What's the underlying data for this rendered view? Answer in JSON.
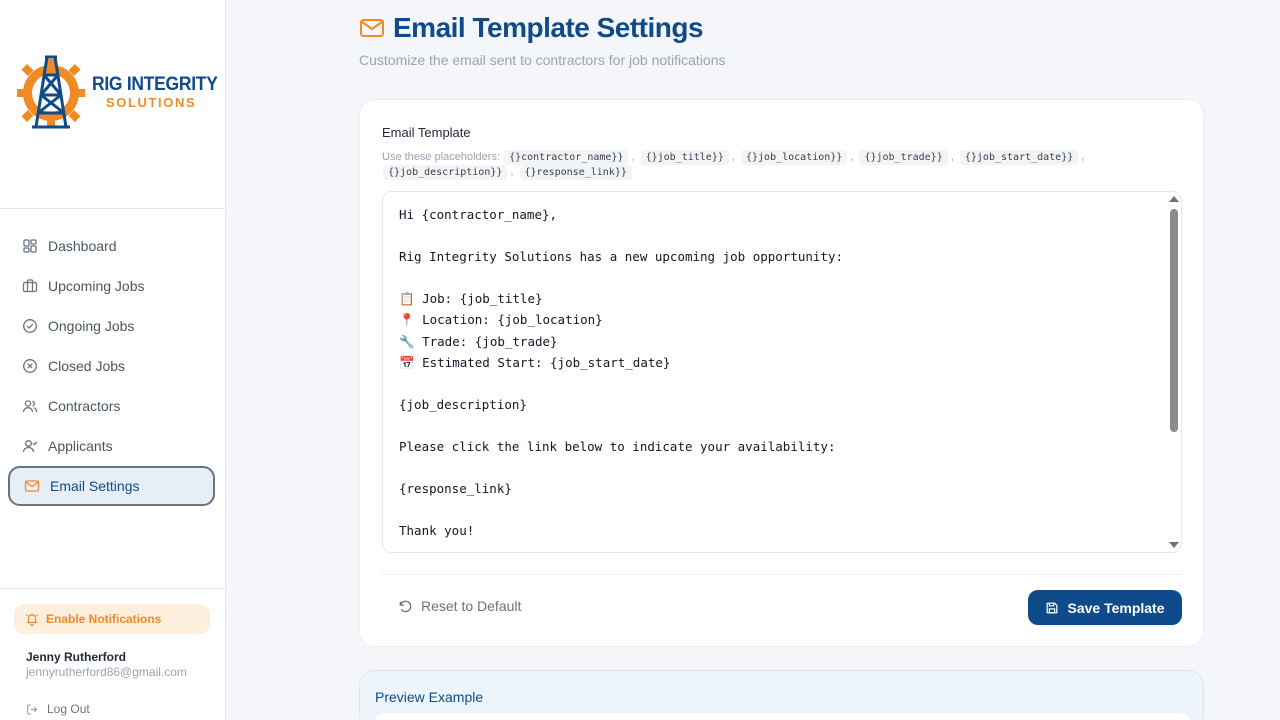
{
  "brand": {
    "line1": "RIG INTEGRITY",
    "line2": "SOLUTIONS",
    "primary_color": "#0f4a8a",
    "accent_color": "#f08a24"
  },
  "sidebar": {
    "items": [
      {
        "label": "Dashboard",
        "icon": "dashboard-icon"
      },
      {
        "label": "Upcoming Jobs",
        "icon": "briefcase-icon"
      },
      {
        "label": "Ongoing Jobs",
        "icon": "check-circle-icon"
      },
      {
        "label": "Closed Jobs",
        "icon": "x-circle-icon"
      },
      {
        "label": "Contractors",
        "icon": "users-icon"
      },
      {
        "label": "Applicants",
        "icon": "user-plus-icon"
      },
      {
        "label": "Email Settings",
        "icon": "mail-icon",
        "active": true
      }
    ],
    "notifications_label": "Enable Notifications",
    "user": {
      "name": "Jenny Rutherford",
      "email": "jennyrutherford86@gmail.com"
    },
    "logout_label": "Log Out"
  },
  "header": {
    "title": "Email Template Settings",
    "subtitle": "Customize the email sent to contractors for job notifications"
  },
  "template_card": {
    "label": "Email Template",
    "placeholders_intro": "Use these placeholders:",
    "placeholders": [
      "{}contractor_name}}",
      "{}job_title}}",
      "{}job_location}}",
      "{}job_trade}}",
      "{}job_start_date}}",
      "{}job_description}}",
      "{}response_link}}"
    ],
    "template_text": "Hi {contractor_name},\n\nRig Integrity Solutions has a new upcoming job opportunity:\n\n📋 Job: {job_title}\n📍 Location: {job_location}\n🔧 Trade: {job_trade}\n📅 Estimated Start: {job_start_date}\n\n{job_description}\n\nPlease click the link below to indicate your availability:\n\n{response_link}\n\nThank you!",
    "reset_label": "Reset to Default",
    "save_label": "Save Template"
  },
  "preview": {
    "title": "Preview Example"
  }
}
